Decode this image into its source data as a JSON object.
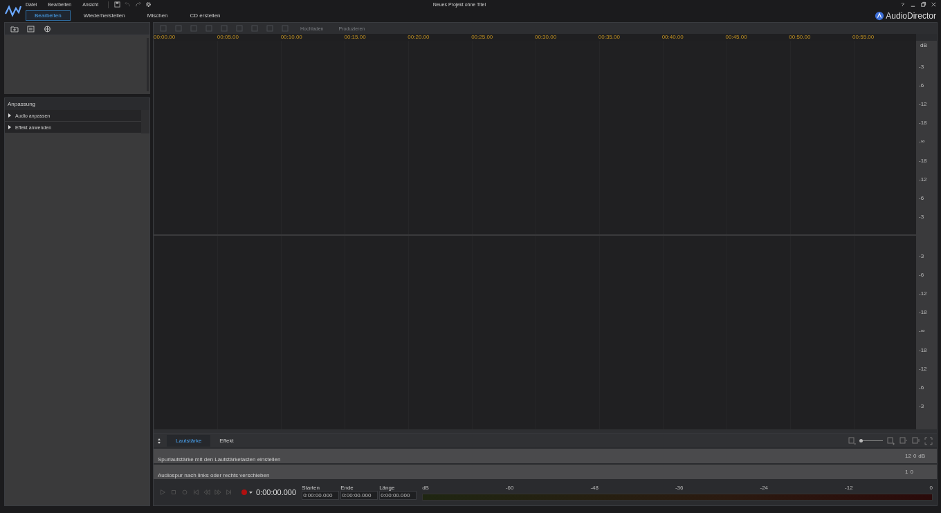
{
  "window": {
    "title": "Neues Projekt ohne Titel",
    "brand": "AudioDirector",
    "help": "?"
  },
  "menu": [
    "Datei",
    "Bearbeiten",
    "Ansicht"
  ],
  "mode_tabs": [
    {
      "label": "Bearbeiten",
      "selected": true
    },
    {
      "label": "Wiederherstellen",
      "selected": false
    },
    {
      "label": "Mischen",
      "selected": false
    },
    {
      "label": "CD erstellen",
      "selected": false
    }
  ],
  "toolbar": {
    "buttons": [
      {
        "label": "Hochladen",
        "disabled": true
      },
      {
        "label": "Produzieren",
        "disabled": true
      }
    ]
  },
  "adjust_panel": {
    "title": "Anpassung",
    "items": [
      {
        "label": "Audio anpassen",
        "expanded": false
      },
      {
        "label": "Effekt anwenden",
        "expanded": false
      }
    ]
  },
  "ruler": [
    "00:00.00",
    "00:05.00",
    "00:10.00",
    "00:15.00",
    "00:20.00",
    "00:25.00",
    "00:30.00",
    "00:35.00",
    "00:40.00",
    "00:45.00",
    "00:50.00",
    "00:55.00"
  ],
  "scale_unit": "dB",
  "channels": [
    {
      "scale": [
        "-3",
        "-6",
        "-12",
        "-18",
        "-∞",
        "-18",
        "-12",
        "-6",
        "-3"
      ]
    },
    {
      "scale": [
        "-3",
        "-6",
        "-12",
        "-18",
        "-∞",
        "-18",
        "-12",
        "-6",
        "-3"
      ]
    }
  ],
  "bottom_tabs": [
    {
      "label": "Lautstärke",
      "selected": true
    },
    {
      "label": "Effekt",
      "selected": false
    }
  ],
  "zoom_slider": {
    "level": 0.05
  },
  "keyframe_rows": [
    {
      "text": "Spurlautstärke mit den Lautstärketasten einstellen",
      "scale": [
        "12",
        "0",
        "dB"
      ]
    },
    {
      "text": "Audiospur nach links oder rechts verschieben",
      "scale": [
        "1",
        "0"
      ]
    }
  ],
  "transport": {
    "timecode": "0:00:00.000",
    "fields": [
      {
        "label": "Starten",
        "value": "0:00:00.000"
      },
      {
        "label": "Ende",
        "value": "0:00:00.000"
      },
      {
        "label": "Länge",
        "value": "0:00:00.000"
      }
    ]
  },
  "meter": {
    "labels": [
      "dB",
      "-60",
      "-48",
      "-36",
      "-24",
      "-12",
      "0"
    ]
  }
}
